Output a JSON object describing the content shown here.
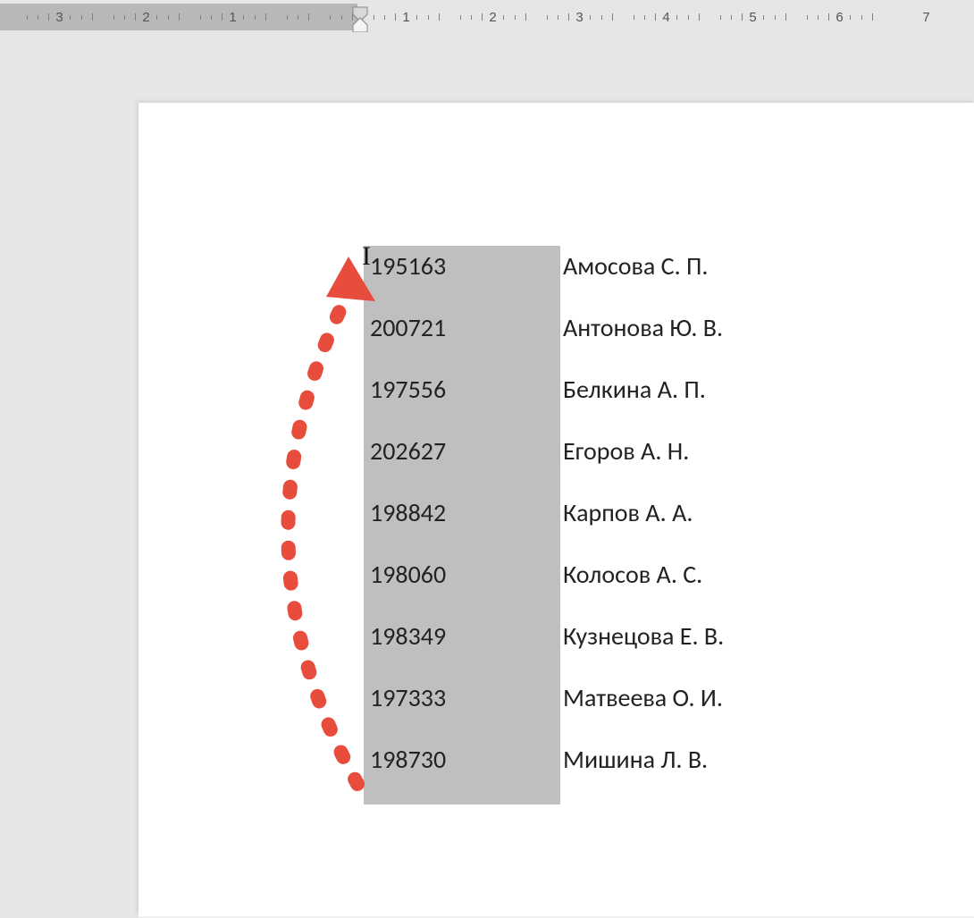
{
  "ruler": {
    "labels": [
      "3",
      "2",
      "1",
      "",
      "1",
      "2",
      "3",
      "4",
      "5",
      "6",
      "7"
    ],
    "zero_index": 3
  },
  "rows": [
    {
      "id": "195163",
      "name": "Амосова С. П."
    },
    {
      "id": "200721",
      "name": "Антонова Ю. В."
    },
    {
      "id": "197556",
      "name": "Белкина А. П."
    },
    {
      "id": "202627",
      "name": "Егоров А. Н."
    },
    {
      "id": "198842",
      "name": "Карпов А. А."
    },
    {
      "id": "198060",
      "name": "Колосов А. С."
    },
    {
      "id": "198349",
      "name": "Кузнецова Е. В."
    },
    {
      "id": "197333",
      "name": "Матвеева О. И."
    },
    {
      "id": "198730",
      "name": "Мишина Л. В."
    }
  ],
  "annotation": {
    "arrow_color": "#e84c3d"
  }
}
